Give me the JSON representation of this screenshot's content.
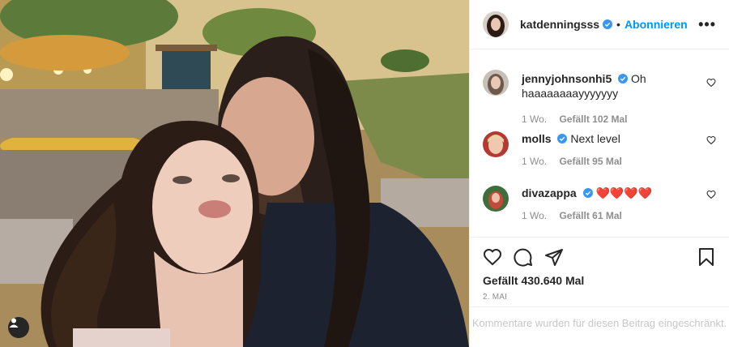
{
  "post": {
    "author": "katdenningsss",
    "follow_label": "Abonnieren",
    "separator": "•",
    "more_label": "•••",
    "likes_text": "Gefällt 430.640 Mal",
    "date": "2. MAI",
    "comments_restricted": "Kommentare wurden für diesen Beitrag eingeschränkt."
  },
  "comments": [
    {
      "user": "jennyjohnsonhi5",
      "text": "Oh haaaaaaaayyyyyyy",
      "age": "1 Wo.",
      "likes": "Gefällt 102 Mal"
    },
    {
      "user": "molls",
      "text": "Next level",
      "age": "1 Wo.",
      "likes": "Gefällt 95 Mal"
    },
    {
      "user": "divazappa",
      "text": "❤️❤️❤️❤️",
      "age": "1 Wo.",
      "likes": "Gefällt 61 Mal"
    }
  ],
  "colors": {
    "accent": "#0095f6",
    "verified": "#3897f0",
    "text": "#262626",
    "muted": "#8e8e8e",
    "heart": "#ed4956"
  },
  "icons": [
    "heart-icon",
    "comment-icon",
    "share-icon",
    "bookmark-icon",
    "verified-badge-icon",
    "user-tag-icon",
    "more-icon"
  ]
}
